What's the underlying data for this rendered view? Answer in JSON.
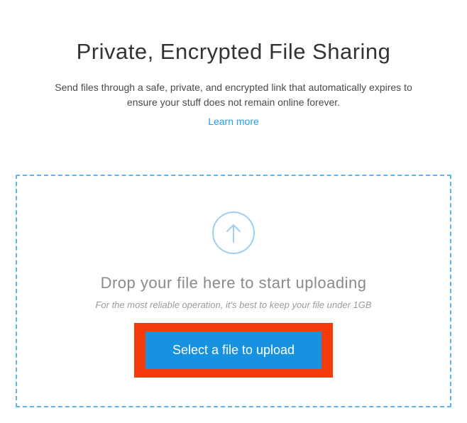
{
  "hero": {
    "title": "Private, Encrypted File Sharing",
    "subtitle": "Send files through a safe, private, and encrypted link that automatically expires to ensure your stuff does not remain online forever.",
    "learn_more": "Learn more"
  },
  "dropzone": {
    "title": "Drop your file here to start uploading",
    "hint": "For the most reliable operation, it's best to keep your file under 1GB",
    "button_label": "Select a file to upload"
  },
  "colors": {
    "accent": "#1692e0",
    "highlight": "#f53b0c",
    "dashed_border": "#5eb4ec"
  }
}
